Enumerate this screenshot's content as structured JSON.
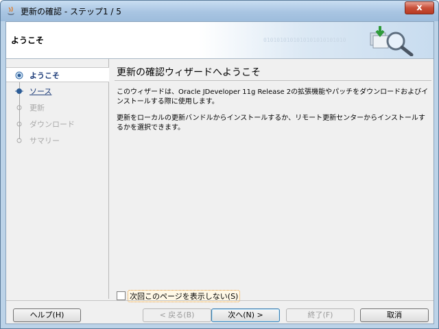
{
  "window": {
    "title": "更新の確認 - ステップ1 / 5",
    "close_label": "x"
  },
  "header": {
    "title": "ようこそ",
    "binary_text": "0101010101010101010101010"
  },
  "nav": {
    "items": [
      {
        "label": "ようこそ"
      },
      {
        "label": "ソース"
      },
      {
        "label": "更新"
      },
      {
        "label": "ダウンロード"
      },
      {
        "label": "サマリー"
      }
    ]
  },
  "content": {
    "title": "更新の確認ウィザードへようこそ",
    "paragraph1": "このウィザードは、Oracle JDeveloper 11g Release 2の拡張機能やパッチをダウンロードおよびインストールする際に使用します。",
    "paragraph2": "更新をローカルの更新バンドルからインストールするか、リモート更新センターからインストールするかを選択できます。",
    "checkbox_label": "次回このページを表示しない(S)"
  },
  "buttons": {
    "help": "ヘルプ(H)",
    "back": "< 戻る(B)",
    "next": "次へ(N) >",
    "finish": "終了(F)",
    "cancel": "取消"
  },
  "colors": {
    "accent": "#1c3b78",
    "close": "#c9503a"
  }
}
